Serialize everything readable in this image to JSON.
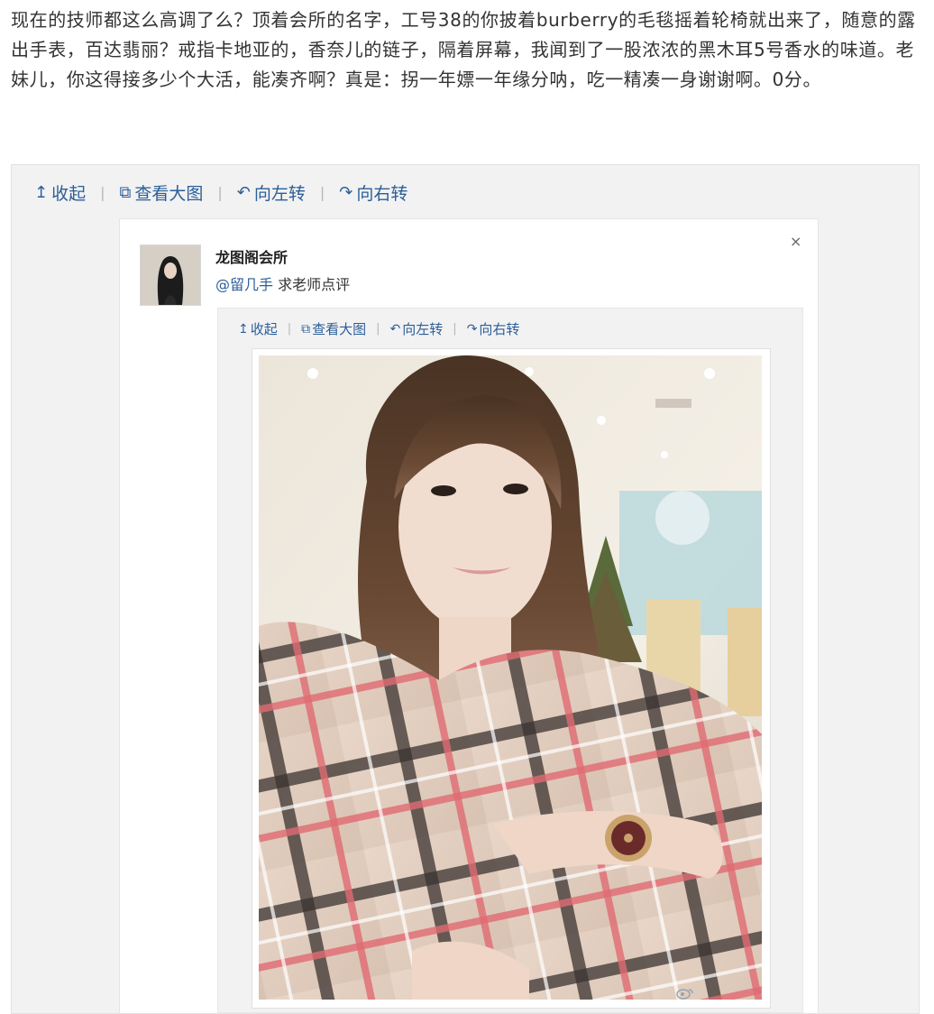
{
  "post": {
    "text": "现在的技师都这么高调了么？顶着会所的名字，工号38的你披着burberry的毛毯摇着轮椅就出来了，随意的露出手表，百达翡丽？戒指卡地亚的，香奈儿的链子，隔着屏幕，我闻到了一股浓浓的黑木耳5号香水的味道。老妹儿，你这得接多少个大活，能凑齐啊？真是：拐一年嫖一年缘分呐，吃一精凑一身谢谢啊。0分。"
  },
  "outer_toolbar": {
    "collapse": {
      "icon": "collapse-up-icon",
      "glyph": "↥",
      "label": "收起"
    },
    "view_large": {
      "icon": "external-view-icon",
      "glyph": "⧉",
      "label": "查看大图"
    },
    "rotate_left": {
      "icon": "rotate-left-icon",
      "glyph": "↶",
      "label": "向左转"
    },
    "rotate_right": {
      "icon": "rotate-right-icon",
      "glyph": "↷",
      "label": "向右转"
    },
    "separator": "|"
  },
  "repost": {
    "author": "龙图阁会所",
    "mention": "@留几手",
    "text": "求老师点评",
    "close_glyph": "×"
  },
  "inner_toolbar": {
    "collapse": {
      "icon": "collapse-up-icon",
      "glyph": "↥",
      "label": "收起"
    },
    "view_large": {
      "icon": "external-view-icon",
      "glyph": "⧉",
      "label": "查看大图"
    },
    "rotate_left": {
      "icon": "rotate-left-icon",
      "glyph": "↶",
      "label": "向左转"
    },
    "rotate_right": {
      "icon": "rotate-right-icon",
      "glyph": "↷",
      "label": "向右转"
    },
    "separator": "|"
  },
  "colors": {
    "link": "#2b5e98",
    "panel": "#f2f2f2",
    "text": "#333333"
  }
}
